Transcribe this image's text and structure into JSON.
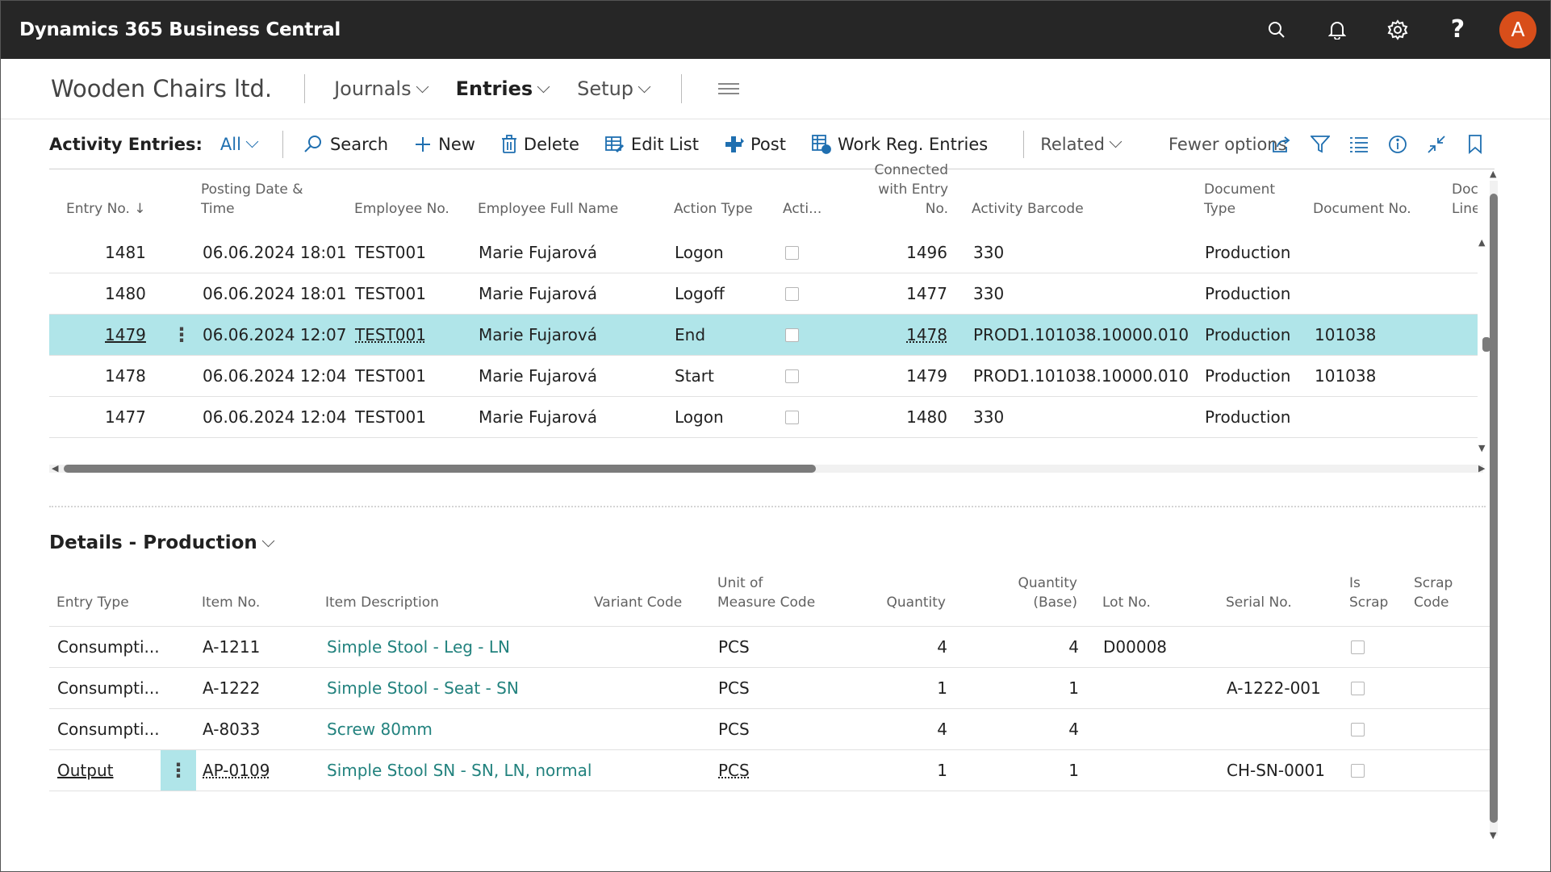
{
  "app": {
    "title": "Dynamics 365 Business Central",
    "avatar_letter": "A",
    "help_glyph": "?"
  },
  "nav": {
    "company": "Wooden Chairs ltd.",
    "items": [
      {
        "label": "Journals",
        "active": false
      },
      {
        "label": "Entries",
        "active": true
      },
      {
        "label": "Setup",
        "active": false
      }
    ]
  },
  "actionbar": {
    "list_label": "Activity Entries:",
    "filter_value": "All",
    "actions": {
      "search": "Search",
      "new": "New",
      "delete": "Delete",
      "edit_list": "Edit List",
      "post": "Post",
      "work_reg": "Work Reg. Entries",
      "related": "Related",
      "fewer": "Fewer options"
    }
  },
  "entries": {
    "headers": {
      "entry_no": "Entry No. ↓",
      "posting_1": "Posting Date &",
      "posting_2": "Time",
      "employee_no": "Employee No.",
      "employee_name": "Employee Full Name",
      "action_type": "Action Type",
      "acti": "Acti...",
      "connected_1": "Connected",
      "connected_2": "with Entry No.",
      "barcode": "Activity Barcode",
      "doctype_1": "Document",
      "doctype_2": "Type",
      "docno": "Document No.",
      "docline_1": "Docur",
      "docline_2": "Line"
    },
    "rows": [
      {
        "entry_no": "1481",
        "posting": "06.06.2024 18:01",
        "employee_no": "TEST001",
        "name": "Marie Fujarová",
        "action": "Logon",
        "connected": "1496",
        "barcode": "330",
        "doctype": "Production",
        "docno": ""
      },
      {
        "entry_no": "1480",
        "posting": "06.06.2024 18:01",
        "employee_no": "TEST001",
        "name": "Marie Fujarová",
        "action": "Logoff",
        "connected": "1477",
        "barcode": "330",
        "doctype": "Production",
        "docno": ""
      },
      {
        "entry_no": "1479",
        "posting": "06.06.2024 12:07",
        "employee_no": "TEST001",
        "name": "Marie Fujarová",
        "action": "End",
        "connected": "1478",
        "barcode": "PROD1.101038.10000.010",
        "doctype": "Production",
        "docno": "101038"
      },
      {
        "entry_no": "1478",
        "posting": "06.06.2024 12:04",
        "employee_no": "TEST001",
        "name": "Marie Fujarová",
        "action": "Start",
        "connected": "1479",
        "barcode": "PROD1.101038.10000.010",
        "doctype": "Production",
        "docno": "101038"
      },
      {
        "entry_no": "1477",
        "posting": "06.06.2024 12:04",
        "employee_no": "TEST001",
        "name": "Marie Fujarová",
        "action": "Logon",
        "connected": "1480",
        "barcode": "330",
        "doctype": "Production",
        "docno": ""
      }
    ]
  },
  "details": {
    "title": "Details - Production",
    "headers": {
      "entry_type": "Entry Type",
      "item_no": "Item No.",
      "item_desc": "Item Description",
      "variant": "Variant Code",
      "uom_1": "Unit of",
      "uom_2": "Measure Code",
      "qty": "Quantity",
      "qty_base": "Quantity (Base)",
      "lot": "Lot No.",
      "serial": "Serial No.",
      "scrap_1": "Is",
      "scrap_2": "Scrap",
      "scrap_code": "Scrap Code"
    },
    "rows": [
      {
        "entry_type": "Consumpti...",
        "item_no": "A-1211",
        "desc": "Simple Stool - Leg - LN",
        "uom": "PCS",
        "qty": "4",
        "qty_base": "4",
        "lot": "D00008",
        "serial": ""
      },
      {
        "entry_type": "Consumpti...",
        "item_no": "A-1222",
        "desc": "Simple Stool - Seat - SN",
        "uom": "PCS",
        "qty": "1",
        "qty_base": "1",
        "lot": "",
        "serial": "A-1222-001"
      },
      {
        "entry_type": "Consumpti...",
        "item_no": "A-8033",
        "desc": "Screw 80mm",
        "uom": "PCS",
        "qty": "4",
        "qty_base": "4",
        "lot": "",
        "serial": ""
      },
      {
        "entry_type": "Output",
        "item_no": "AP-0109",
        "desc": "Simple Stool SN - SN, LN, normal",
        "uom": "PCS",
        "qty": "1",
        "qty_base": "1",
        "lot": "",
        "serial": "CH-SN-0001"
      }
    ]
  },
  "colors": {
    "topbar": "#262626",
    "accent": "#1f6fb0",
    "selected_row": "#b0e5e9",
    "link": "#22827e",
    "avatar": "#d84e1a"
  }
}
